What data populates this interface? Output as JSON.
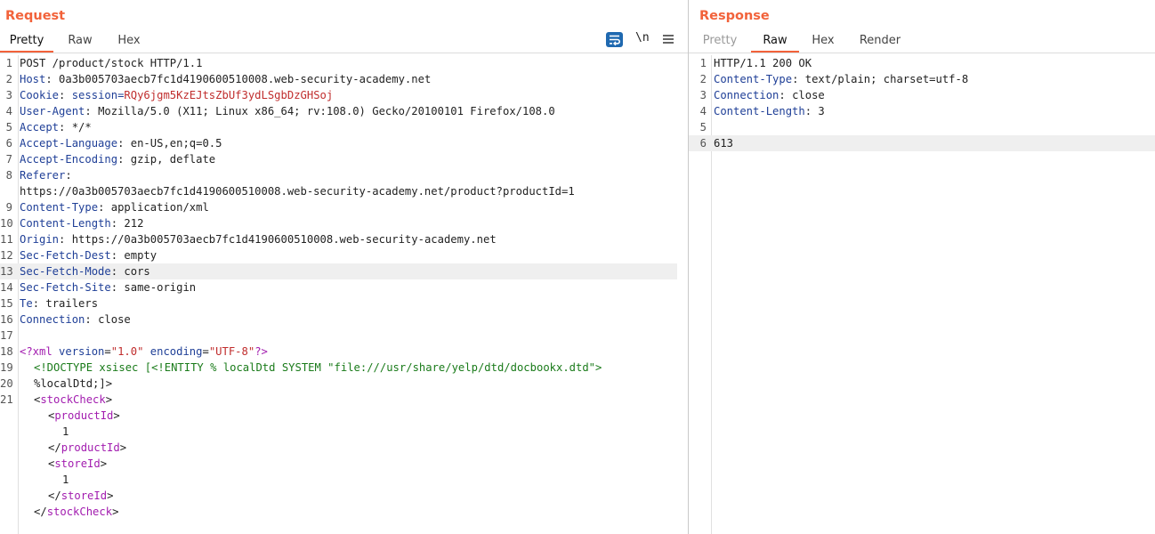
{
  "request": {
    "title": "Request",
    "tabs": [
      "Pretty",
      "Raw",
      "Hex"
    ],
    "active_tab": "Pretty",
    "toolbar": {
      "newline_label": "\\n",
      "wrap_icon": "wrap-lines-icon",
      "menu_icon": "hamburger-menu-icon"
    },
    "lines": [
      {
        "n": "1",
        "text": "POST /product/stock HTTP/1.1"
      },
      {
        "n": "2",
        "key": "Host",
        "value": "0a3b005703aecb7fc1d4190600510008.web-security-academy.net"
      },
      {
        "n": "3",
        "key": "Cookie",
        "value_prefix": "session=",
        "value": "RQy6jgm5KzEJtsZbUf3ydLSgbDzGHSoj"
      },
      {
        "n": "4",
        "key": "User-Agent",
        "value": "Mozilla/5.0 (X11; Linux x86_64; rv:108.0) Gecko/20100101 Firefox/108.0"
      },
      {
        "n": "5",
        "key": "Accept",
        "value": "*/*"
      },
      {
        "n": "6",
        "key": "Accept-Language",
        "value": "en-US,en;q=0.5"
      },
      {
        "n": "7",
        "key": "Accept-Encoding",
        "value": "gzip, deflate"
      },
      {
        "n": "8",
        "key": "Referer",
        "value": ""
      },
      {
        "n": "",
        "text": "https://0a3b005703aecb7fc1d4190600510008.web-security-academy.net/product?productId=1"
      },
      {
        "n": "9",
        "key": "Content-Type",
        "value": "application/xml"
      },
      {
        "n": "10",
        "key": "Content-Length",
        "value": "212"
      },
      {
        "n": "11",
        "key": "Origin",
        "value": "https://0a3b005703aecb7fc1d4190600510008.web-security-academy.net"
      },
      {
        "n": "12",
        "key": "Sec-Fetch-Dest",
        "value": "empty"
      },
      {
        "n": "13",
        "key": "Sec-Fetch-Mode",
        "value": "cors"
      },
      {
        "n": "14",
        "key": "Sec-Fetch-Site",
        "value": "same-origin"
      },
      {
        "n": "15",
        "key": "Te",
        "value": "trailers"
      },
      {
        "n": "16",
        "key": "Connection",
        "value": "close"
      },
      {
        "n": "17",
        "text": ""
      }
    ],
    "xml": {
      "decl_n": "18",
      "decl_open": "<?xml",
      "decl_attr1": "version",
      "decl_val1": "\"1.0\"",
      "decl_attr2": "encoding",
      "decl_val2": "\"UTF-8\"",
      "decl_close": "?>",
      "doctype_n": "19",
      "doctype": "<!DOCTYPE xsisec [<!ENTITY % localDtd SYSTEM \"file:///usr/share/yelp/dtd/docbookx.dtd\">",
      "entity_n": "20",
      "entity_ref": "%localDtd;]>",
      "root_n": "21",
      "root_open": "stockCheck",
      "product_tag": "productId",
      "product_value": "1",
      "store_tag": "storeId",
      "store_value": "1"
    },
    "highlighted_line": "13"
  },
  "response": {
    "title": "Response",
    "tabs": [
      "Pretty",
      "Raw",
      "Hex",
      "Render"
    ],
    "active_tab": "Raw",
    "lines": [
      {
        "n": "1",
        "text": "HTTP/1.1 200 OK"
      },
      {
        "n": "2",
        "key": "Content-Type",
        "value": "text/plain; charset=utf-8"
      },
      {
        "n": "3",
        "key": "Connection",
        "value": "close"
      },
      {
        "n": "4",
        "key": "Content-Length",
        "value": "3"
      },
      {
        "n": "5",
        "text": ""
      },
      {
        "n": "6",
        "text": "613"
      }
    ],
    "highlighted_line": "6"
  },
  "colors": {
    "accent": "#f2623a",
    "header_key": "#1f3f97",
    "string": "#c02d2d",
    "tag": "#a21caf",
    "doctype": "#1a7b1a"
  }
}
